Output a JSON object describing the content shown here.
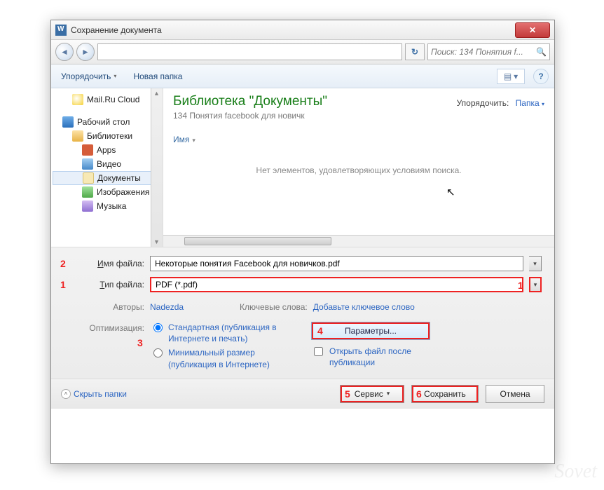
{
  "titlebar": {
    "title": "Сохранение документа"
  },
  "navbar": {
    "back_glyph": "◄",
    "fwd_glyph": "►",
    "breadcrumb_text": "",
    "refresh_glyph": "↻",
    "search_placeholder": "Поиск: 134 Понятия f...",
    "search_icon": "🔍"
  },
  "toolbar": {
    "organize": "Упорядочить",
    "new_folder": "Новая папка",
    "view_glyph": "▤",
    "help_glyph": "?"
  },
  "tree": {
    "mailru": "Mail.Ru Cloud",
    "desktop": "Рабочий стол",
    "libraries": "Библиотеки",
    "apps": "Apps",
    "video": "Видео",
    "documents": "Документы",
    "images": "Изображения",
    "music": "Музыка"
  },
  "main": {
    "lib_title": "Библиотека \"Документы\"",
    "lib_sub": "134 Понятия facebook для новичк",
    "sort_label": "Упорядочить:",
    "sort_value": "Папка",
    "col_name": "Имя",
    "empty": "Нет элементов, удовлетворяющих условиям поиска."
  },
  "form": {
    "filename_label": "Имя файла:",
    "filename_value": "Некоторые понятия Facebook для новичков.pdf",
    "filetype_label": "Тип файла:",
    "filetype_value": "PDF (*.pdf)",
    "authors_label": "Авторы:",
    "authors_value": "Nadezda",
    "tags_label": "Ключевые слова:",
    "tags_value": "Добавьте ключевое слово",
    "opt_label": "Оптимизация:",
    "radio1": "Стандартная (публикация в Интернете и печать)",
    "radio2": "Минимальный размер (публикация в Интернете)",
    "params_btn": "Параметры...",
    "open_after": "Открыть файл после публикации"
  },
  "callouts": {
    "c1a": "1",
    "c1b": "1",
    "c2": "2",
    "c3": "3",
    "c4": "4",
    "c5": "5",
    "c6": "6"
  },
  "footer": {
    "hide": "Скрыть папки",
    "service": "Сервис",
    "save": "Сохранить",
    "cancel": "Отмена"
  },
  "watermark": "Sovet"
}
